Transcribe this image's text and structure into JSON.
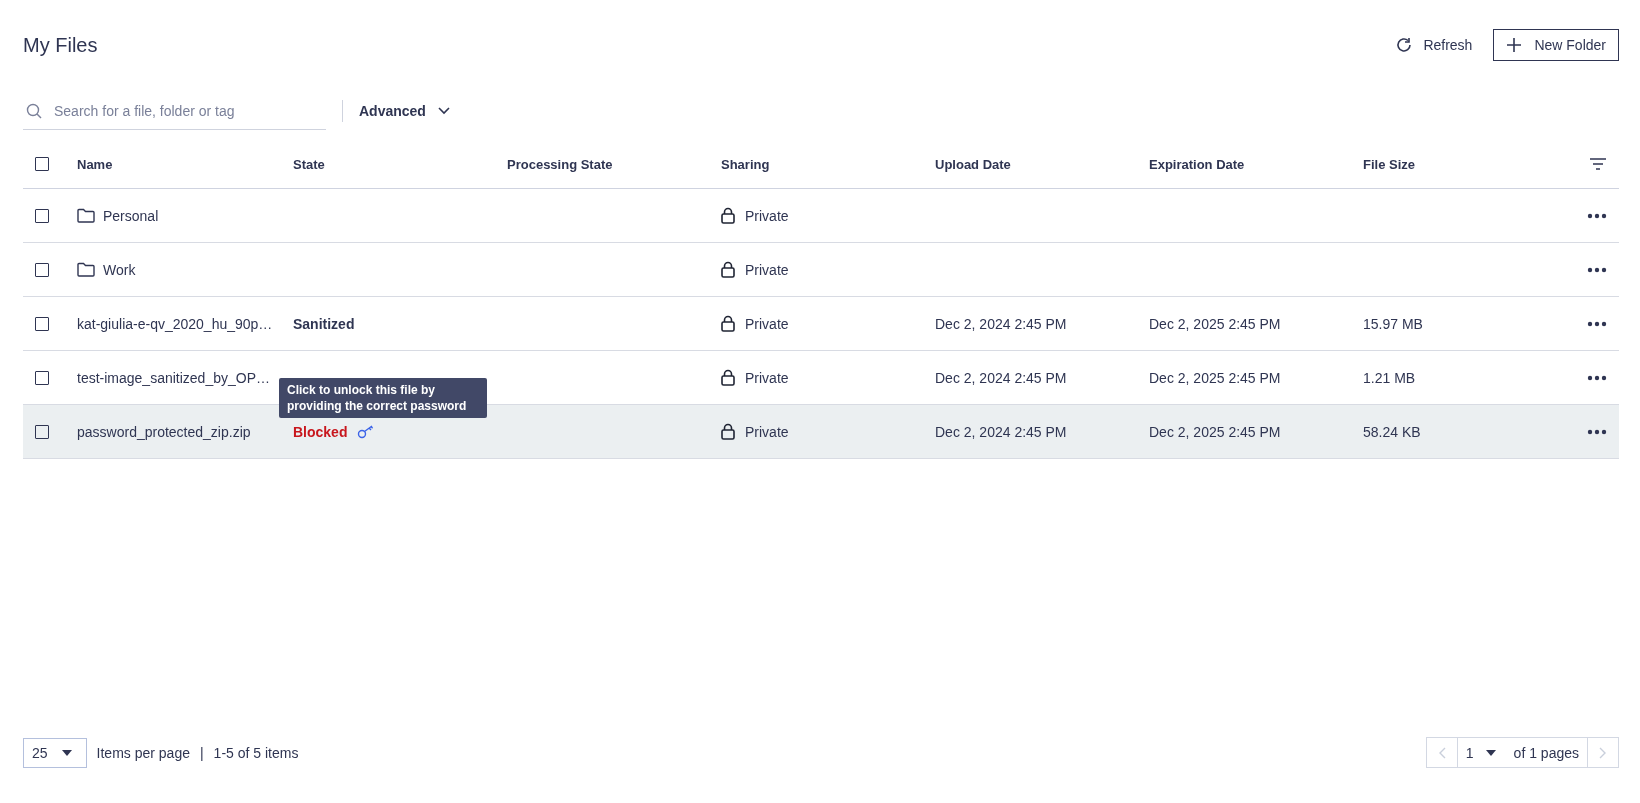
{
  "header": {
    "title": "My Files",
    "actions": [
      {
        "kind": "refresh",
        "label": "Refresh"
      },
      {
        "kind": "new-folder",
        "label": "New Folder"
      }
    ]
  },
  "search": {
    "placeholder": "Search for a file, folder or tag"
  },
  "advanced": {
    "label": "Advanced"
  },
  "table": {
    "select_all_checked": false,
    "columns": [
      "Name",
      "State",
      "Processing State",
      "Sharing",
      "Upload Date",
      "Expiration Date",
      "File Size"
    ],
    "rows": [
      {
        "kind": "folder",
        "checked": false,
        "hovered": false,
        "name": "Personal",
        "sharing": "Private"
      },
      {
        "kind": "folder",
        "checked": false,
        "hovered": false,
        "name": "Work",
        "sharing": "Private"
      },
      {
        "kind": "file",
        "checked": false,
        "hovered": false,
        "name": "kat-giulia-e-qv_2020_hu_90p…",
        "state": {
          "kind": "sanitized",
          "label": "Sanitized"
        },
        "sharing": "Private",
        "upload_date": "Dec 2, 2024 2:45 PM",
        "expiration_date": "Dec 2, 2025 2:45 PM",
        "file_size": "15.97 MB"
      },
      {
        "kind": "file",
        "checked": false,
        "hovered": false,
        "name": "test-image_sanitized_by_OP…",
        "sharing": "Private",
        "upload_date": "Dec 2, 2024 2:45 PM",
        "expiration_date": "Dec 2, 2025 2:45 PM",
        "file_size": "1.21 MB"
      },
      {
        "kind": "file",
        "checked": false,
        "hovered": true,
        "name": "password_protected_zip.zip",
        "state": {
          "kind": "blocked",
          "label": "Blocked",
          "tooltip": "Click to unlock this file by providing the correct password"
        },
        "sharing": "Private",
        "upload_date": "Dec 2, 2024 2:45 PM",
        "expiration_date": "Dec 2, 2025 2:45 PM",
        "file_size": "58.24 KB"
      }
    ]
  },
  "footer": {
    "page_size": "25",
    "items_per_page": "Items per page",
    "separator": "|",
    "range": "1-5 of 5 items",
    "page": "1",
    "of_pages": "of 1 pages"
  }
}
